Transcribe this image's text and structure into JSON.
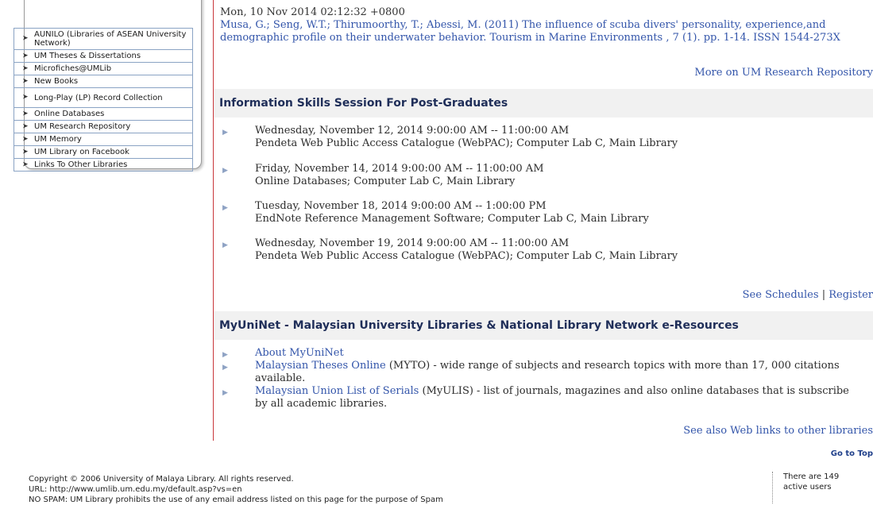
{
  "sidebar": {
    "items": [
      {
        "label": "AUNILO (Libraries of ASEAN University Network)",
        "tall": true
      },
      {
        "label": "UM Theses & Dissertations",
        "tall": false
      },
      {
        "label": "Microfiches@UMLib",
        "tall": false
      },
      {
        "label": "New Books",
        "tall": false
      },
      {
        "label": "Long-Play (LP) Record Collection",
        "tall": true
      },
      {
        "label": "Online Databases",
        "tall": false
      },
      {
        "label": "UM Research Repository",
        "tall": false
      },
      {
        "label": "UM Memory",
        "tall": false
      },
      {
        "label": "UM Library on Facebook",
        "tall": false
      },
      {
        "label": "Links To Other Libraries",
        "tall": false
      }
    ]
  },
  "repository": {
    "timestamp": "Mon, 10 Nov 2014 02:12:32 +0800",
    "reference": "Musa, G.; Seng, W.T.; Thirumoorthy, T.; Abessi, M. (2011) The influence of scuba divers' personality, experience,and demographic profile on their underwater behavior. Tourism in Marine Environments , 7 (1). pp. 1-14. ISSN 1544-273X",
    "more_link": "More on UM Research Repository"
  },
  "info_skills": {
    "heading": "Information Skills Session For Post-Graduates",
    "events": [
      {
        "when": "Wednesday, November 12, 2014 9:00:00 AM -- 11:00:00 AM",
        "what": "Pendeta Web Public Access Catalogue (WebPAC); Computer Lab C, Main Library"
      },
      {
        "when": "Friday, November 14, 2014 9:00:00 AM -- 11:00:00 AM",
        "what": "Online Databases; Computer Lab C, Main Library"
      },
      {
        "when": "Tuesday, November 18, 2014 9:00:00 AM -- 1:00:00 PM",
        "what": "EndNote Reference Management Software; Computer Lab C, Main Library"
      },
      {
        "when": "Wednesday, November 19, 2014 9:00:00 AM -- 11:00:00 AM",
        "what": "Pendeta Web Public Access Catalogue (WebPAC); Computer Lab C, Main Library"
      }
    ],
    "see_schedules": "See Schedules",
    "separator": "|",
    "register": "Register"
  },
  "myuninet": {
    "heading": "MyUniNet - Malaysian University Libraries & National Library Network e-Resources",
    "items": [
      {
        "link": "About MyUniNet",
        "rest": ""
      },
      {
        "link": "Malaysian Theses Online",
        "rest": " (MYTO) - wide range of subjects and research topics with more than 17, 000 citations available."
      },
      {
        "link": "Malaysian Union List of Serials",
        "rest": " (MyULIS) - list of journals, magazines and also online databases that is subscribe by all academic libraries."
      }
    ],
    "see_also": "See also Web links to other libraries"
  },
  "go_to_top": "Go to Top",
  "footer": {
    "copyright": "Copyright © 2006 University of Malaya Library. All rights reserved.",
    "url": "URL: http://www.umlib.um.edu.my/default.asp?vs=en",
    "nospam": "NO SPAM: UM Library prohibits the use of any email address listed on this page for the purpose of Spam",
    "active_users_line1": "There are 149",
    "active_users_line2": "active users"
  }
}
